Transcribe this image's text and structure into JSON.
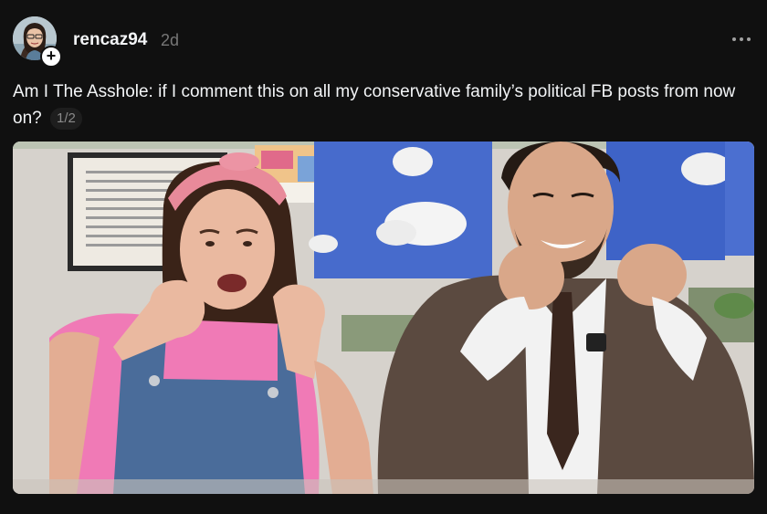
{
  "post": {
    "username": "rencaz94",
    "timestamp": "2d",
    "caption": "Am I The Asshole: if I comment this on all my conservative family’s political FB posts from now on?",
    "page_counter": "1/2",
    "follow_symbol": "+",
    "icons": {
      "more": "more-horizontal-icon",
      "follow": "plus-icon"
    }
  },
  "colors": {
    "background": "#101010",
    "text_primary": "#f3f5f7",
    "text_secondary": "#777777"
  }
}
